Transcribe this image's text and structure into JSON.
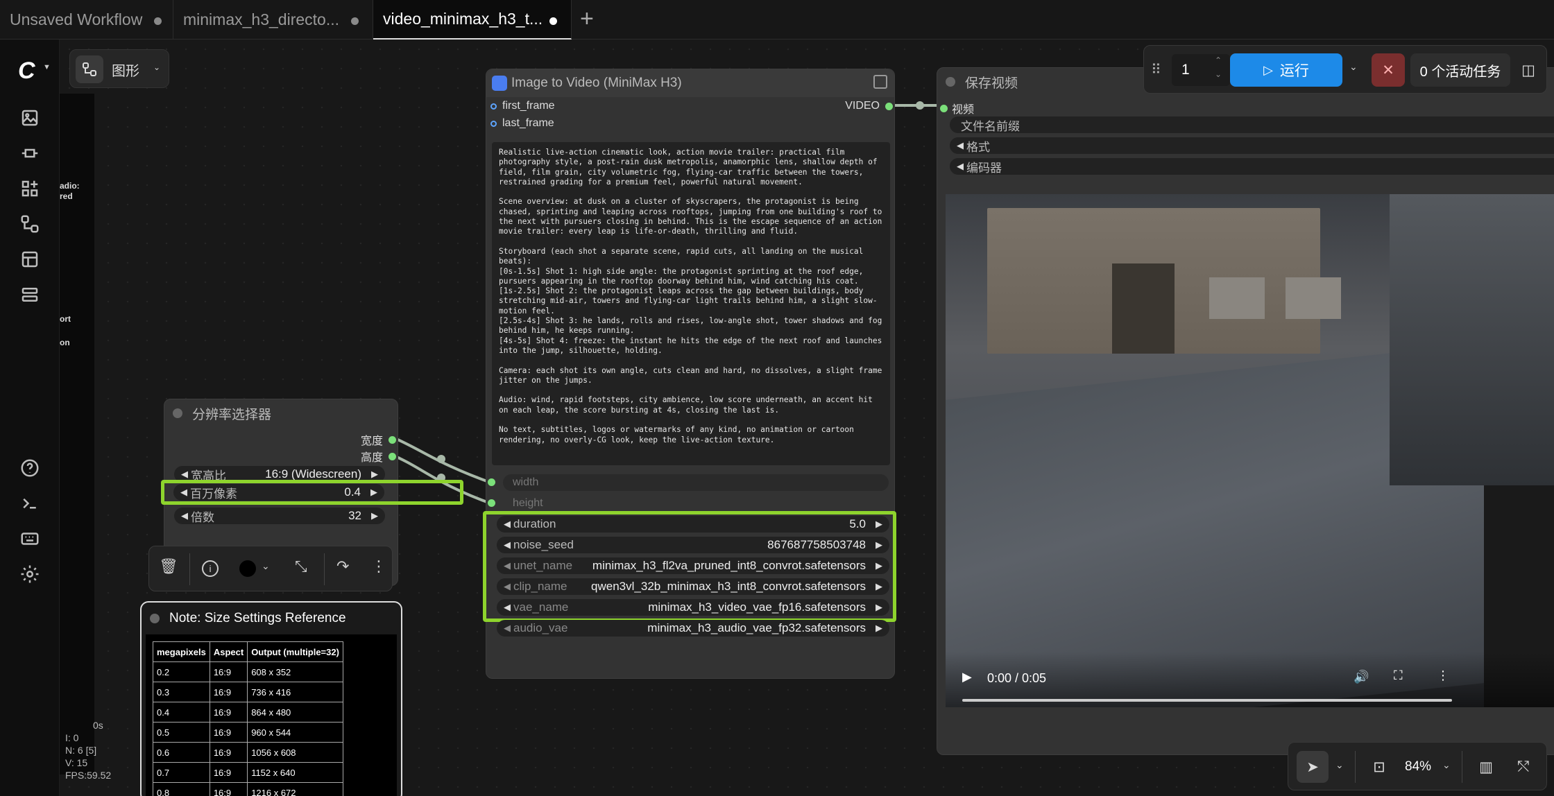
{
  "tabs": [
    {
      "label": "Unsaved Workflow"
    },
    {
      "label": "minimax_h3_directo..."
    },
    {
      "label": "video_minimax_h3_t..."
    }
  ],
  "tab_add": "+",
  "toolbar_top": {
    "graph_label": "图形"
  },
  "side_panel": {
    "audio_label": "adio:",
    "audio_label2": "red",
    "port_label": "ort",
    "on_label": "on"
  },
  "stats": {
    "t": "0s",
    "i": "I: 0",
    "n": "N: 6 [5]",
    "v": "V: 15",
    "fps": "FPS:59.52"
  },
  "run_panel": {
    "batch": "1",
    "run_label": "运行",
    "tasks_label": "0 个活动任务"
  },
  "node_video": {
    "title": "Image to Video (MiniMax H3)",
    "inputs": [
      "first_frame",
      "last_frame"
    ],
    "output": "VIDEO",
    "prompt": "Realistic live-action cinematic look, action movie trailer: practical film photography style, a post-rain dusk metropolis, anamorphic lens, shallow depth of field, film grain, city volumetric fog, flying-car traffic between the towers, restrained grading for a premium feel, powerful natural movement.\n\nScene overview: at dusk on a cluster of skyscrapers, the protagonist is being chased, sprinting and leaping across rooftops, jumping from one building's roof to the next with pursuers closing in behind. This is the escape sequence of an action movie trailer: every leap is life-or-death, thrilling and fluid.\n\nStoryboard (each shot a separate scene, rapid cuts, all landing on the musical beats):\n[0s-1.5s] Shot 1: high side angle: the protagonist sprinting at the roof edge, pursuers appearing in the rooftop doorway behind him, wind catching his coat.\n[1s-2.5s] Shot 2: the protagonist leaps across the gap between buildings, body stretching mid-air, towers and flying-car light trails behind him, a slight slow-motion feel.\n[2.5s-4s] Shot 3: he lands, rolls and rises, low-angle shot, tower shadows and fog behind him, he keeps running.\n[4s-5s] Shot 4: freeze: the instant he hits the edge of the next roof and launches into the jump, silhouette, holding.\n\nCamera: each shot its own angle, cuts clean and hard, no dissolves, a slight frame jitter on the jumps.\n\nAudio: wind, rapid footsteps, city ambience, low score underneath, an accent hit on each leap, the score bursting at 4s, closing the last is.\n\nNo text, subtitles, logos or watermarks of any kind, no animation or cartoon rendering, no overly-CG look, keep the live-action texture.",
    "linked_inputs": [
      "width",
      "height"
    ],
    "widgets": [
      {
        "label": "duration",
        "value": "5.0"
      },
      {
        "label": "noise_seed",
        "value": "867687758503748"
      },
      {
        "label": "unet_name",
        "value": "minimax_h3_fl2va_pruned_int8_convrot.safetensors"
      },
      {
        "label": "clip_name",
        "value": "qwen3vl_32b_minimax_h3_int8_convrot.safetensors"
      },
      {
        "label": "vae_name",
        "value": "minimax_h3_video_vae_fp16.safetensors"
      },
      {
        "label": "audio_vae",
        "value": "minimax_h3_audio_vae_fp32.safetensors"
      }
    ]
  },
  "node_res": {
    "title": "分辨率选择器",
    "outputs": [
      "宽度",
      "高度"
    ],
    "widgets": [
      {
        "label": "宽高比",
        "value": "16:9 (Widescreen)"
      },
      {
        "label": "百万像素",
        "value": "0.4"
      },
      {
        "label": "倍数",
        "value": "32"
      }
    ]
  },
  "node_save": {
    "title": "保存视频",
    "input": "视频",
    "widgets": [
      "文件名前缀",
      "格式",
      "编码器"
    ],
    "time": "0:00 / 0:05"
  },
  "note": {
    "title": "Note: Size Settings Reference",
    "headers": [
      "megapixels",
      "Aspect",
      "Output (multiple=32)"
    ],
    "rows": [
      [
        "0.2",
        "16:9",
        "608 x 352"
      ],
      [
        "0.3",
        "16:9",
        "736 x 416"
      ],
      [
        "0.4",
        "16:9",
        "864 x 480"
      ],
      [
        "0.5",
        "16:9",
        "960 x 544"
      ],
      [
        "0.6",
        "16:9",
        "1056 x 608"
      ],
      [
        "0.7",
        "16:9",
        "1152 x 640"
      ],
      [
        "0.8",
        "16:9",
        "1216 x 672"
      ]
    ]
  },
  "zoom": "84%",
  "colors": {
    "accent_run": "#1d8ae8",
    "highlight": "#8ed42d",
    "link": "#7be07a",
    "stop": "#a33a3a"
  }
}
